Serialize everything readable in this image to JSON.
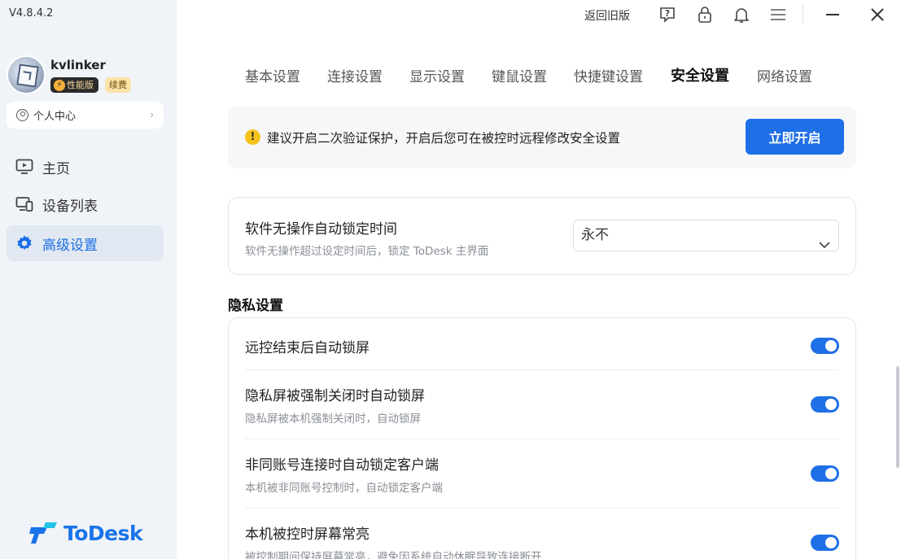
{
  "app": {
    "version": "V4.8.4.2",
    "brand": "ToDesk"
  },
  "user": {
    "name": "kvlinker",
    "badge_plan": "性能版",
    "badge_renew": "续费",
    "center_label": "个人中心"
  },
  "sidebar": {
    "items": [
      {
        "label": "主页",
        "icon": "monitor-icon"
      },
      {
        "label": "设备列表",
        "icon": "devices-icon"
      },
      {
        "label": "高级设置",
        "icon": "gear-icon",
        "active": true
      }
    ]
  },
  "titlebar": {
    "back_old": "返回旧版"
  },
  "tabs": [
    {
      "label": "基本设置"
    },
    {
      "label": "连接设置"
    },
    {
      "label": "显示设置"
    },
    {
      "label": "键鼠设置"
    },
    {
      "label": "快捷键设置"
    },
    {
      "label": "安全设置",
      "active": true
    },
    {
      "label": "网络设置"
    }
  ],
  "notice": {
    "text": "建议开启二次验证保护，开启后您可在被控时远程修改安全设置",
    "button": "立即开启"
  },
  "autolock": {
    "title": "软件无操作自动锁定时间",
    "subtitle": "软件无操作超过设定时间后，锁定 ToDesk 主界面",
    "value": "永不"
  },
  "privacy": {
    "section_title": "隐私设置",
    "rows": [
      {
        "title": "远控结束后自动锁屏",
        "subtitle": "",
        "enabled": true
      },
      {
        "title": "隐私屏被强制关闭时自动锁屏",
        "subtitle": "隐私屏被本机强制关闭时，自动锁屏",
        "enabled": true
      },
      {
        "title": "非同账号连接时自动锁定客户端",
        "subtitle": "本机被非同账号控制时，自动锁定客户端",
        "enabled": true
      },
      {
        "title": "本机被控时屏幕常亮",
        "subtitle": "被控制期间保持屏幕常亮，避免因系统自动休眠导致连接断开",
        "enabled": true
      }
    ]
  },
  "colors": {
    "accent": "#1f6fe6",
    "sidebar_bg": "#f0f3f8",
    "warning": "#f7c21a"
  }
}
